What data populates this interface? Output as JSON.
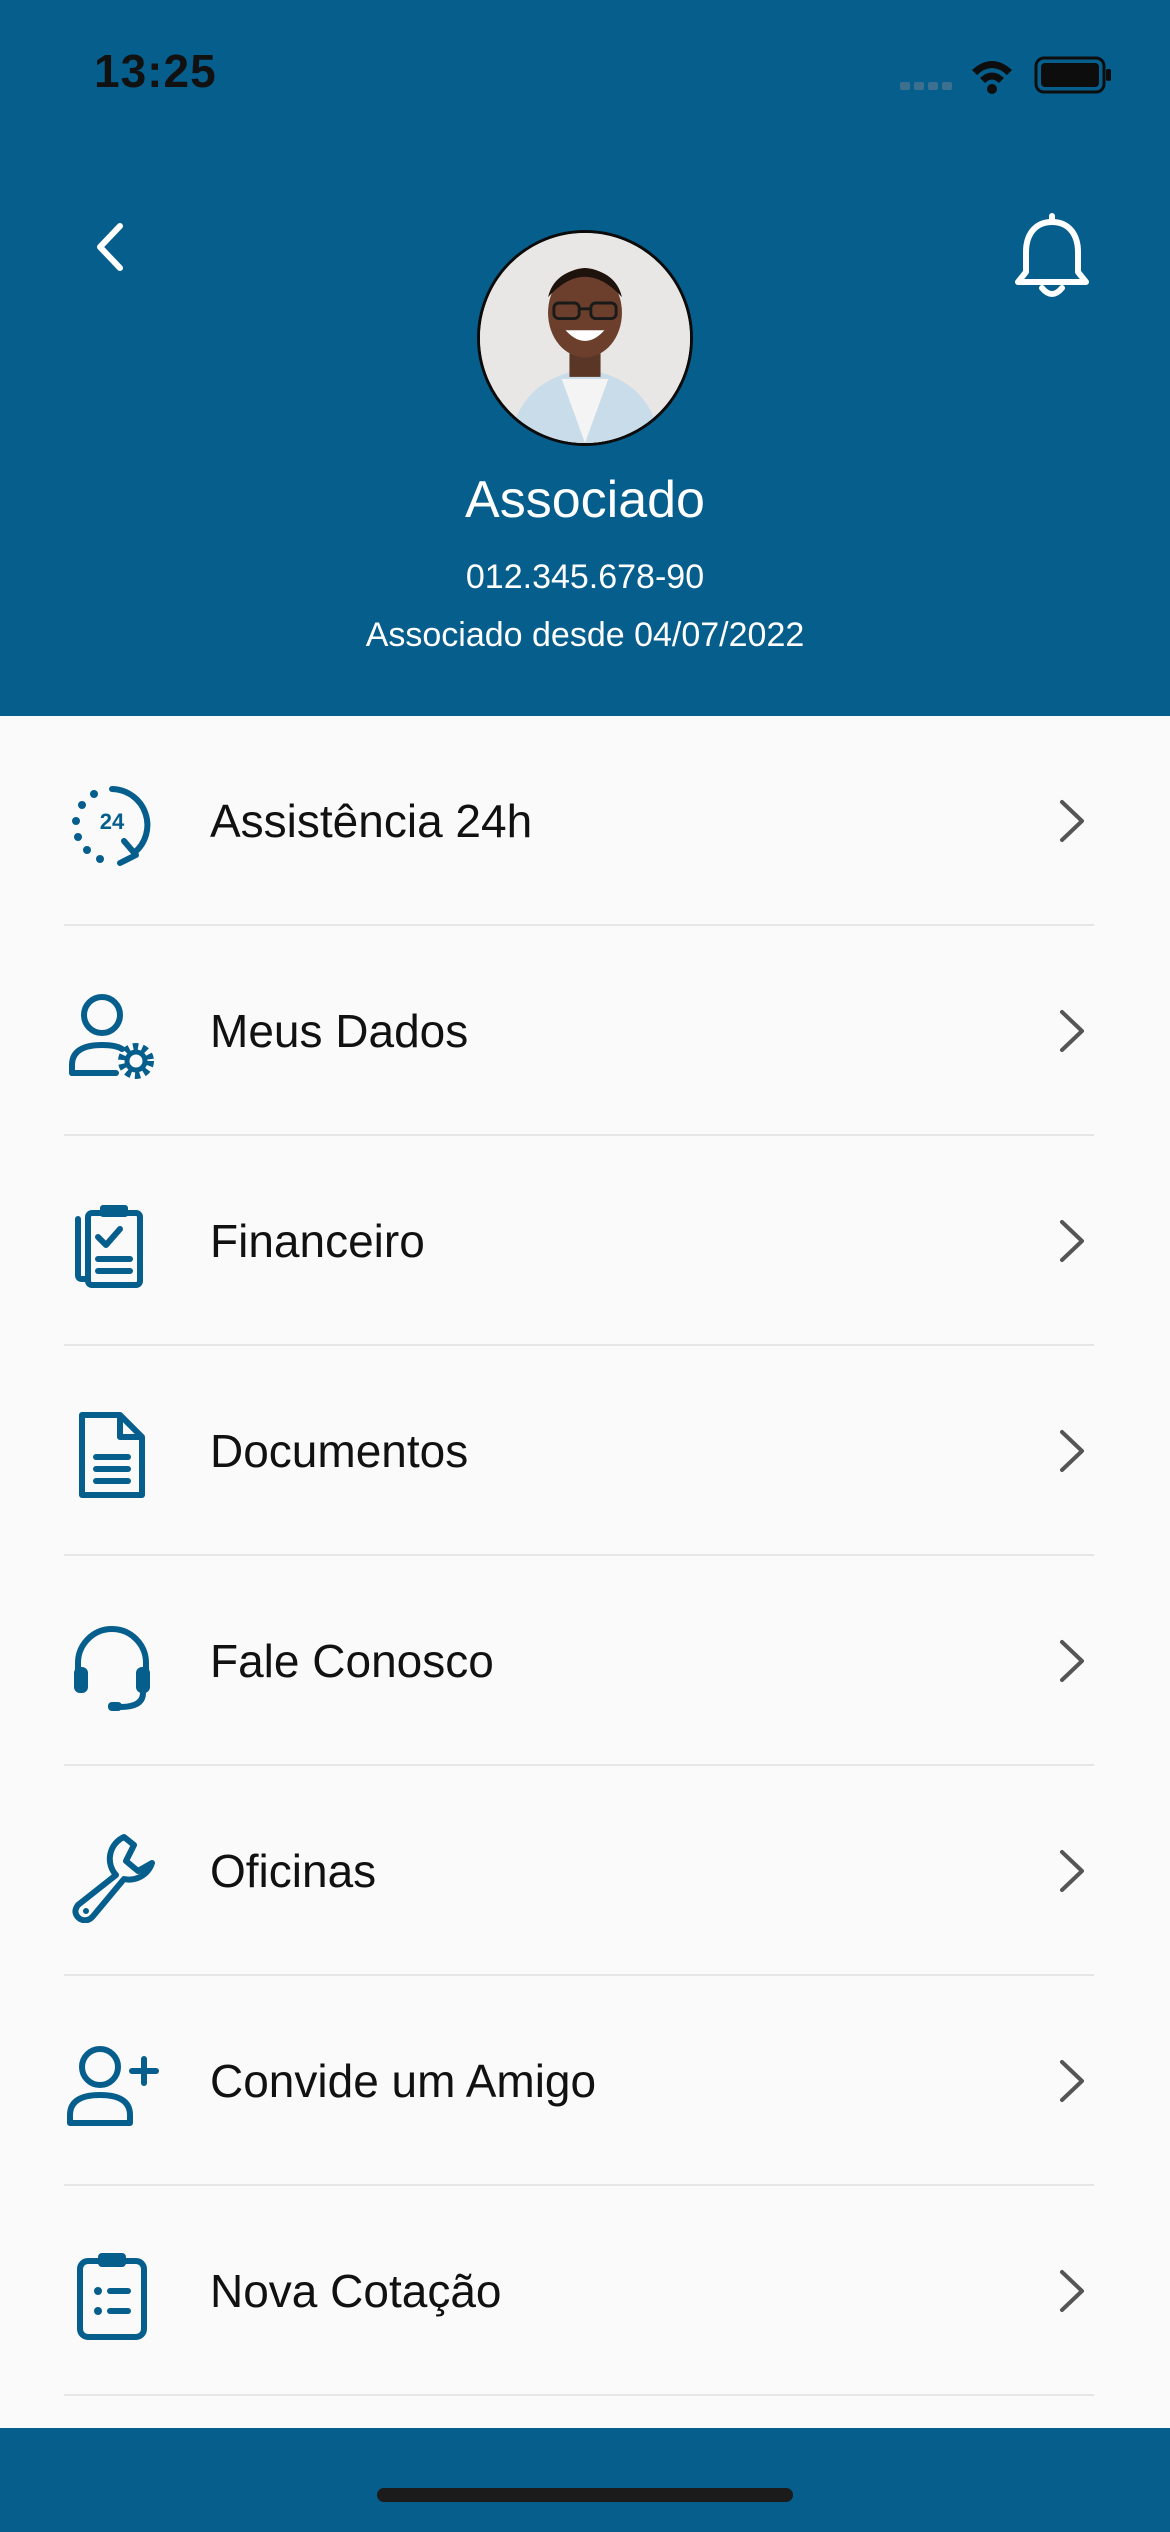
{
  "status_bar": {
    "time": "13:25"
  },
  "profile": {
    "name": "Associado",
    "cpf": "012.345.678-90",
    "member_since": "Associado desde 04/07/2022"
  },
  "menu": [
    {
      "label": "Assistência 24h",
      "icon": "assistance-24h-icon"
    },
    {
      "label": "Meus Dados",
      "icon": "user-gear-icon"
    },
    {
      "label": "Financeiro",
      "icon": "financial-clipboard-icon"
    },
    {
      "label": "Documentos",
      "icon": "document-icon"
    },
    {
      "label": "Fale Conosco",
      "icon": "headset-icon"
    },
    {
      "label": "Oficinas",
      "icon": "wrench-icon"
    },
    {
      "label": "Convide um Amigo",
      "icon": "user-plus-icon"
    },
    {
      "label": "Nova Cotação",
      "icon": "clipboard-list-icon"
    }
  ],
  "colors": {
    "brand": "#065e8c",
    "background": "#fafafa",
    "text": "#111111",
    "chevron": "#555555"
  }
}
